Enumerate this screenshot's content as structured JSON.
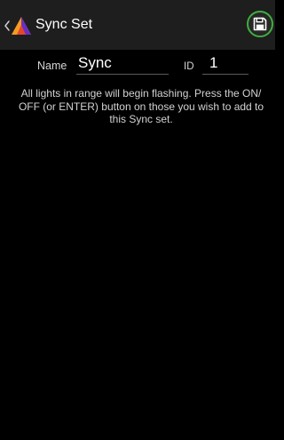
{
  "app_bar": {
    "title": "Sync Set",
    "back_icon": "chevron-left-icon",
    "logo_icon": "app-logo-icon",
    "save_icon": "floppy-disk-icon"
  },
  "form": {
    "name_label": "Name",
    "name_value": "Sync",
    "id_label": "ID",
    "id_value": "1"
  },
  "instructions": "All lights in range will begin flashing. Press the ON/ OFF (or ENTER) button on those you wish to add to this Sync set.",
  "colors": {
    "background": "#000000",
    "app_bar": "#1e1e1e",
    "save_ring": "#3fae3f",
    "logo_orange": "#f59a23",
    "logo_purple": "#6a2fc4"
  }
}
